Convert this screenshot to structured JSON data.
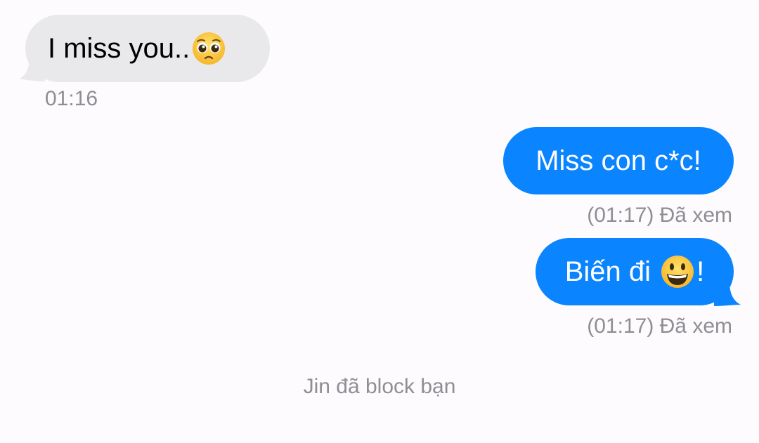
{
  "conversation": {
    "messages": [
      {
        "direction": "incoming",
        "text": "I miss you..",
        "emoji": "pleading-face",
        "time": "01:16"
      },
      {
        "direction": "outgoing",
        "text": "Miss con c*c!",
        "status": "(01:17) Đã xem"
      },
      {
        "direction": "outgoing",
        "text_before": "Biến đi ",
        "emoji": "grinning-face",
        "text_after": "!",
        "status": "(01:17) Đã xem"
      }
    ],
    "system_note": "Jin đã block bạn"
  },
  "colors": {
    "background": "#fdfbfe",
    "incoming_bubble": "#e9e9eb",
    "outgoing_bubble": "#0a84ff",
    "meta_text": "#8e8e93"
  }
}
